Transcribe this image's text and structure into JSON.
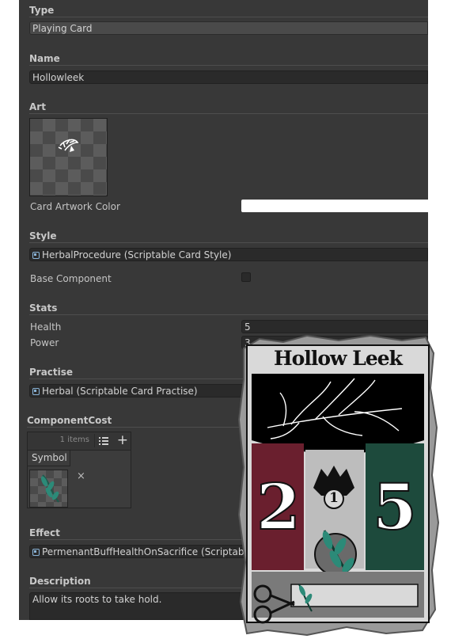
{
  "inspector": {
    "type": {
      "header": "Type",
      "value": "Playing Card"
    },
    "name": {
      "header": "Name",
      "value": "Hollowleek"
    },
    "art": {
      "header": "Art",
      "color_label": "Card Artwork Color",
      "color_value": "#ffffff"
    },
    "style": {
      "header": "Style",
      "value": "HerbalProcedure (Scriptable Card Style)",
      "base_component_label": "Base Component",
      "base_component_checked": false
    },
    "stats": {
      "header": "Stats",
      "health_label": "Health",
      "health_value": "5",
      "power_label": "Power",
      "power_value": "3"
    },
    "practise": {
      "header": "Practise",
      "value": "Herbal (Scriptable Card Practise)"
    },
    "component_cost": {
      "header": "ComponentCost",
      "count": "1 items",
      "add_label": "+",
      "column": "Symbol",
      "remove_label": "×"
    },
    "effect": {
      "header": "Effect",
      "value": "PermenantBuffHealthOnSacrifice (Scriptable"
    },
    "description": {
      "header": "Description",
      "value": "Allow its roots to take hold."
    }
  },
  "card": {
    "title": "Hollow Leek",
    "attack": "2",
    "health": "5",
    "cost": "1",
    "colors": {
      "left_banner": "#6a1f2e",
      "right_banner": "#1d4a3c",
      "leaf": "#2c7a6a",
      "frame": "#d9d9d9"
    }
  }
}
